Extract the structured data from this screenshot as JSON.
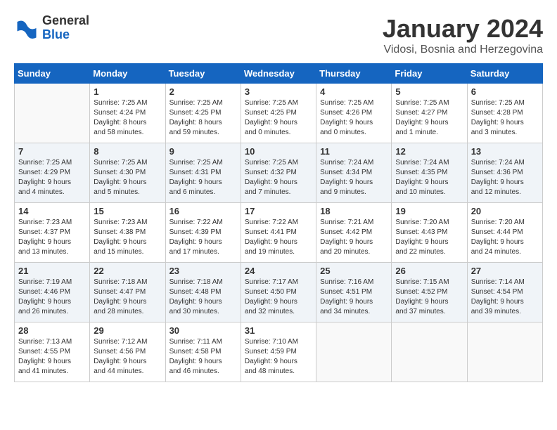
{
  "logo": {
    "general": "General",
    "blue": "Blue"
  },
  "header": {
    "month": "January 2024",
    "location": "Vidosi, Bosnia and Herzegovina"
  },
  "days_of_week": [
    "Sunday",
    "Monday",
    "Tuesday",
    "Wednesday",
    "Thursday",
    "Friday",
    "Saturday"
  ],
  "weeks": [
    [
      {
        "day": "",
        "info": ""
      },
      {
        "day": "1",
        "info": "Sunrise: 7:25 AM\nSunset: 4:24 PM\nDaylight: 8 hours\nand 58 minutes."
      },
      {
        "day": "2",
        "info": "Sunrise: 7:25 AM\nSunset: 4:25 PM\nDaylight: 8 hours\nand 59 minutes."
      },
      {
        "day": "3",
        "info": "Sunrise: 7:25 AM\nSunset: 4:25 PM\nDaylight: 9 hours\nand 0 minutes."
      },
      {
        "day": "4",
        "info": "Sunrise: 7:25 AM\nSunset: 4:26 PM\nDaylight: 9 hours\nand 0 minutes."
      },
      {
        "day": "5",
        "info": "Sunrise: 7:25 AM\nSunset: 4:27 PM\nDaylight: 9 hours\nand 1 minute."
      },
      {
        "day": "6",
        "info": "Sunrise: 7:25 AM\nSunset: 4:28 PM\nDaylight: 9 hours\nand 3 minutes."
      }
    ],
    [
      {
        "day": "7",
        "info": "Sunrise: 7:25 AM\nSunset: 4:29 PM\nDaylight: 9 hours\nand 4 minutes."
      },
      {
        "day": "8",
        "info": "Sunrise: 7:25 AM\nSunset: 4:30 PM\nDaylight: 9 hours\nand 5 minutes."
      },
      {
        "day": "9",
        "info": "Sunrise: 7:25 AM\nSunset: 4:31 PM\nDaylight: 9 hours\nand 6 minutes."
      },
      {
        "day": "10",
        "info": "Sunrise: 7:25 AM\nSunset: 4:32 PM\nDaylight: 9 hours\nand 7 minutes."
      },
      {
        "day": "11",
        "info": "Sunrise: 7:24 AM\nSunset: 4:34 PM\nDaylight: 9 hours\nand 9 minutes."
      },
      {
        "day": "12",
        "info": "Sunrise: 7:24 AM\nSunset: 4:35 PM\nDaylight: 9 hours\nand 10 minutes."
      },
      {
        "day": "13",
        "info": "Sunrise: 7:24 AM\nSunset: 4:36 PM\nDaylight: 9 hours\nand 12 minutes."
      }
    ],
    [
      {
        "day": "14",
        "info": "Sunrise: 7:23 AM\nSunset: 4:37 PM\nDaylight: 9 hours\nand 13 minutes."
      },
      {
        "day": "15",
        "info": "Sunrise: 7:23 AM\nSunset: 4:38 PM\nDaylight: 9 hours\nand 15 minutes."
      },
      {
        "day": "16",
        "info": "Sunrise: 7:22 AM\nSunset: 4:39 PM\nDaylight: 9 hours\nand 17 minutes."
      },
      {
        "day": "17",
        "info": "Sunrise: 7:22 AM\nSunset: 4:41 PM\nDaylight: 9 hours\nand 19 minutes."
      },
      {
        "day": "18",
        "info": "Sunrise: 7:21 AM\nSunset: 4:42 PM\nDaylight: 9 hours\nand 20 minutes."
      },
      {
        "day": "19",
        "info": "Sunrise: 7:20 AM\nSunset: 4:43 PM\nDaylight: 9 hours\nand 22 minutes."
      },
      {
        "day": "20",
        "info": "Sunrise: 7:20 AM\nSunset: 4:44 PM\nDaylight: 9 hours\nand 24 minutes."
      }
    ],
    [
      {
        "day": "21",
        "info": "Sunrise: 7:19 AM\nSunset: 4:46 PM\nDaylight: 9 hours\nand 26 minutes."
      },
      {
        "day": "22",
        "info": "Sunrise: 7:18 AM\nSunset: 4:47 PM\nDaylight: 9 hours\nand 28 minutes."
      },
      {
        "day": "23",
        "info": "Sunrise: 7:18 AM\nSunset: 4:48 PM\nDaylight: 9 hours\nand 30 minutes."
      },
      {
        "day": "24",
        "info": "Sunrise: 7:17 AM\nSunset: 4:50 PM\nDaylight: 9 hours\nand 32 minutes."
      },
      {
        "day": "25",
        "info": "Sunrise: 7:16 AM\nSunset: 4:51 PM\nDaylight: 9 hours\nand 34 minutes."
      },
      {
        "day": "26",
        "info": "Sunrise: 7:15 AM\nSunset: 4:52 PM\nDaylight: 9 hours\nand 37 minutes."
      },
      {
        "day": "27",
        "info": "Sunrise: 7:14 AM\nSunset: 4:54 PM\nDaylight: 9 hours\nand 39 minutes."
      }
    ],
    [
      {
        "day": "28",
        "info": "Sunrise: 7:13 AM\nSunset: 4:55 PM\nDaylight: 9 hours\nand 41 minutes."
      },
      {
        "day": "29",
        "info": "Sunrise: 7:12 AM\nSunset: 4:56 PM\nDaylight: 9 hours\nand 44 minutes."
      },
      {
        "day": "30",
        "info": "Sunrise: 7:11 AM\nSunset: 4:58 PM\nDaylight: 9 hours\nand 46 minutes."
      },
      {
        "day": "31",
        "info": "Sunrise: 7:10 AM\nSunset: 4:59 PM\nDaylight: 9 hours\nand 48 minutes."
      },
      {
        "day": "",
        "info": ""
      },
      {
        "day": "",
        "info": ""
      },
      {
        "day": "",
        "info": ""
      }
    ]
  ]
}
